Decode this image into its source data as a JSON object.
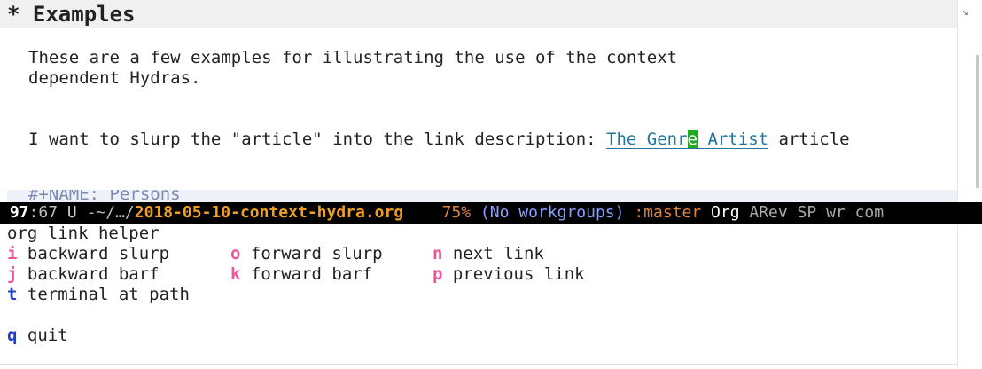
{
  "buffer": {
    "heading": "* Examples",
    "paragraph_line1": "These are a few examples for illustrating the use of the context",
    "paragraph_line2": "dependent Hydras.",
    "slurp_prefix": "I want to slurp the \"article\" into the link description: ",
    "link_before_cursor": "The Genr",
    "cursor_char": "e",
    "link_after_cursor": " Artist",
    "slurp_suffix": " article",
    "name_line": "#+NAME: Persons"
  },
  "modeline": {
    "line": "97",
    "column": ":67",
    "encoding": " U ",
    "path": "-~/…/",
    "filename": "2018-05-10-context-hydra.org",
    "percent": "75%",
    "workgroups": "(No workgroups)",
    "branch": ":master",
    "major_mode": "Org",
    "minor_modes": "ARev SP wr com"
  },
  "hydra": {
    "title": "org link helper",
    "heads": [
      {
        "key": "i",
        "label": "backward slurp",
        "color": "#ee5599"
      },
      {
        "key": "o",
        "label": "forward slurp",
        "color": "#ee5599"
      },
      {
        "key": "n",
        "label": "next link",
        "color": "#ee5599"
      },
      {
        "key": "j",
        "label": "backward barf",
        "color": "#ee5599"
      },
      {
        "key": "k",
        "label": "forward barf",
        "color": "#ee5599"
      },
      {
        "key": "p",
        "label": "previous link",
        "color": "#ee5599"
      },
      {
        "key": "t",
        "label": "terminal at path",
        "color": "#1e3fd0"
      },
      {
        "key": "q",
        "label": "quit",
        "color": "#1e3fd0"
      }
    ]
  },
  "colors": {
    "link": "#23759f",
    "cursor": "#22aa22",
    "pink_key": "#ee5599",
    "blue_key": "#1e3fd0",
    "file_name": "#f0a020"
  }
}
